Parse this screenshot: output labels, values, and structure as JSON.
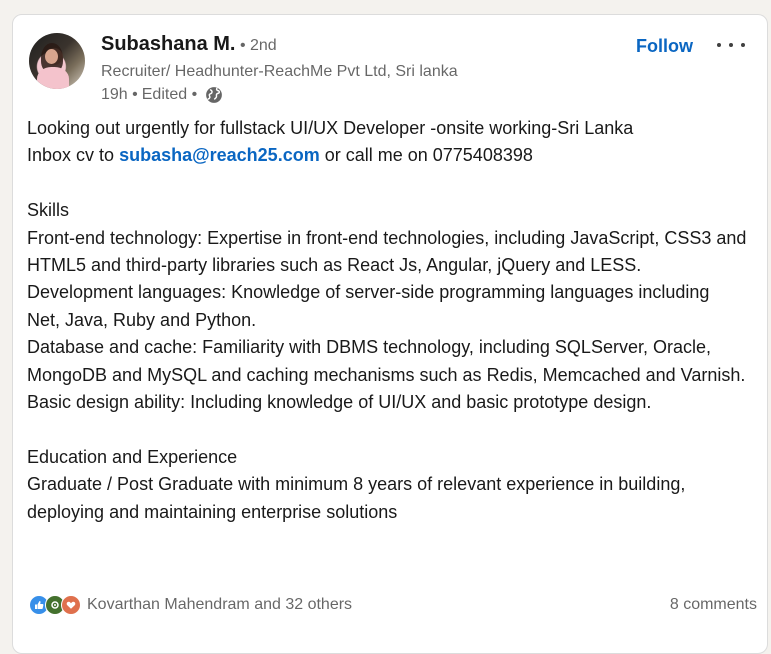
{
  "post": {
    "author": {
      "name": "Subashana M.",
      "degree": "• 2nd",
      "headline": "Recruiter/ Headhunter-ReachMe Pvt Ltd, Sri lanka",
      "time": "19h •",
      "edited": "Edited •"
    },
    "actions": {
      "follow_label": "Follow"
    },
    "content": {
      "line1": "Looking out urgently for fullstack UI/UX Developer -onsite working-Sri Lanka",
      "inbox_prefix": "Inbox cv to ",
      "email": "subasha@reach25.com",
      "inbox_suffix": " or call me on 0775408398",
      "skills_heading": "Skills",
      "frontend": "Front-end technology: Expertise in front-end technologies, including JavaScript, CSS3 and HTML5 and third-party libraries such as React Js, Angular, jQuery and LESS.",
      "devlang": "Development languages: Knowledge of server-side programming languages including Net, Java, Ruby and Python.",
      "database": "Database and cache: Familiarity with DBMS technology, including SQLServer, Oracle, MongoDB and MySQL and caching mechanisms such as Redis, Memcached and Varnish.",
      "design": "Basic design ability: Including knowledge of UI/UX and basic prototype design.",
      "edu_heading": "Education and Experience",
      "edu_text": "Graduate / Post Graduate with minimum 8 years of relevant experience in building, deploying and maintaining enterprise solutions"
    },
    "social": {
      "reactions_text": "Kovarthan Mahendram and 32 others",
      "reaction_icons": [
        "like-icon",
        "celebrate-icon",
        "love-icon"
      ],
      "comments_text": "8 comments"
    },
    "colors": {
      "link": "#0a66c2",
      "like": "#378fe9",
      "celebrate": "#44712e",
      "love": "#df704d"
    }
  }
}
